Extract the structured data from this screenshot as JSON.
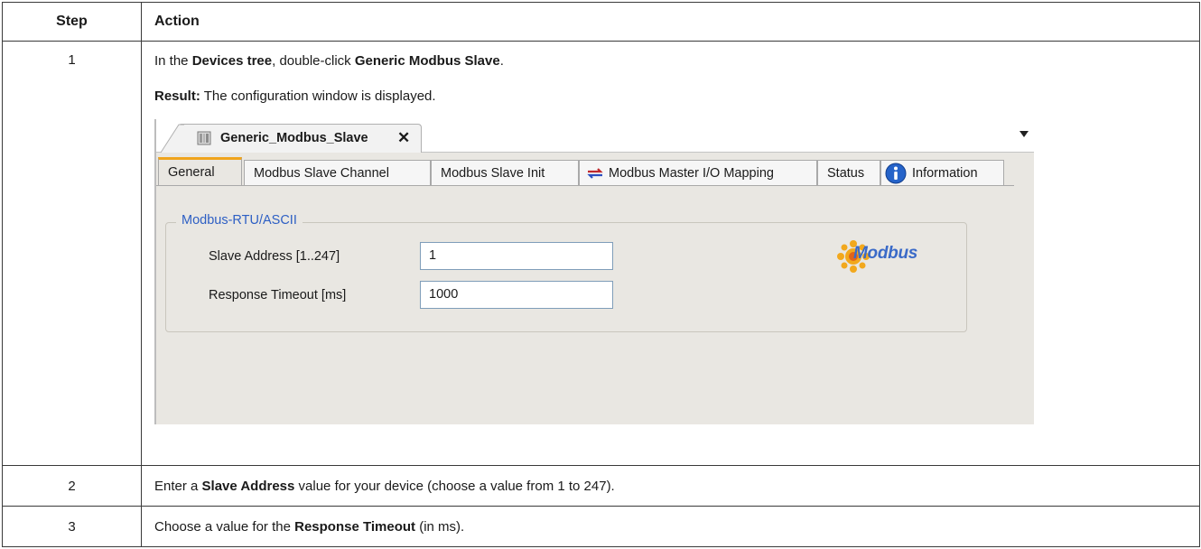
{
  "table": {
    "header_step": "Step",
    "header_action": "Action"
  },
  "rows": [
    {
      "step": "1",
      "line1": {
        "p1": "In the ",
        "b1": "Devices tree",
        "p2": ", double-click ",
        "b2": "Generic Modbus Slave",
        "p3": "."
      },
      "line2": {
        "b1": "Result:",
        "p1": " The configuration window is displayed."
      }
    },
    {
      "step": "2",
      "line": {
        "p1": "Enter a ",
        "b1": "Slave Address",
        "p2": " value for your device (choose a value from 1 to 247)."
      }
    },
    {
      "step": "3",
      "line": {
        "p1": "Choose a value for the ",
        "b1": "Response Timeout",
        "p2": " (in ms)."
      }
    }
  ],
  "screenshot": {
    "doc_tab_title": "Generic_Modbus_Slave",
    "close_glyph": "✕",
    "tabs": [
      "General",
      "Modbus Slave Channel",
      "Modbus Slave Init",
      "Modbus Master I/O Mapping",
      "Status",
      "Information"
    ],
    "active_tab": "General",
    "group_title": "Modbus-RTU/ASCII",
    "fields": [
      {
        "label": "Slave Address [1..247]",
        "value": "1"
      },
      {
        "label": "Response Timeout [ms]",
        "value": "1000"
      }
    ],
    "logo_text": "Modbus",
    "icons": [
      "device-icon",
      "close-icon",
      "dropdown-arrow-icon",
      "mapping-arrows-icon",
      "info-icon",
      "modbus-logo"
    ],
    "colors": {
      "active_tab_accent": "#f0a41c",
      "group_title": "#2d5fc4",
      "panel_bg": "#e9e7e2"
    }
  }
}
